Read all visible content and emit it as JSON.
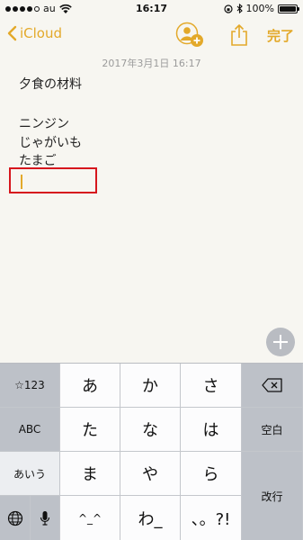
{
  "status_bar": {
    "carrier": "au",
    "time": "16:17",
    "battery_percent": "100%",
    "battery_level": 1.0,
    "signal_bars_filled": 4,
    "signal_bars_total": 5
  },
  "nav": {
    "back_label": "iCloud",
    "done_label": "完了"
  },
  "note": {
    "date": "2017年3月1日 16:17",
    "lines": [
      "夕食の材料",
      "ニンジン",
      "じゃがいも",
      "たまご"
    ]
  },
  "keyboard": {
    "row1": [
      "☆123",
      "あ",
      "か",
      "さ"
    ],
    "row2": [
      "ABC",
      "た",
      "な",
      "は",
      "空白"
    ],
    "row3": [
      "あいう",
      "ま",
      "や",
      "ら",
      "改行"
    ],
    "row4": [
      "^_^",
      "わ_",
      "、。?!"
    ],
    "delete_icon": "backspace-icon",
    "globe_icon": "globe-icon",
    "mic_icon": "microphone-icon"
  },
  "colors": {
    "accent": "#e3a92a",
    "highlight_box": "#d6161d",
    "background": "#f7f6f1",
    "keyboard_bg": "#d1d4d9"
  }
}
